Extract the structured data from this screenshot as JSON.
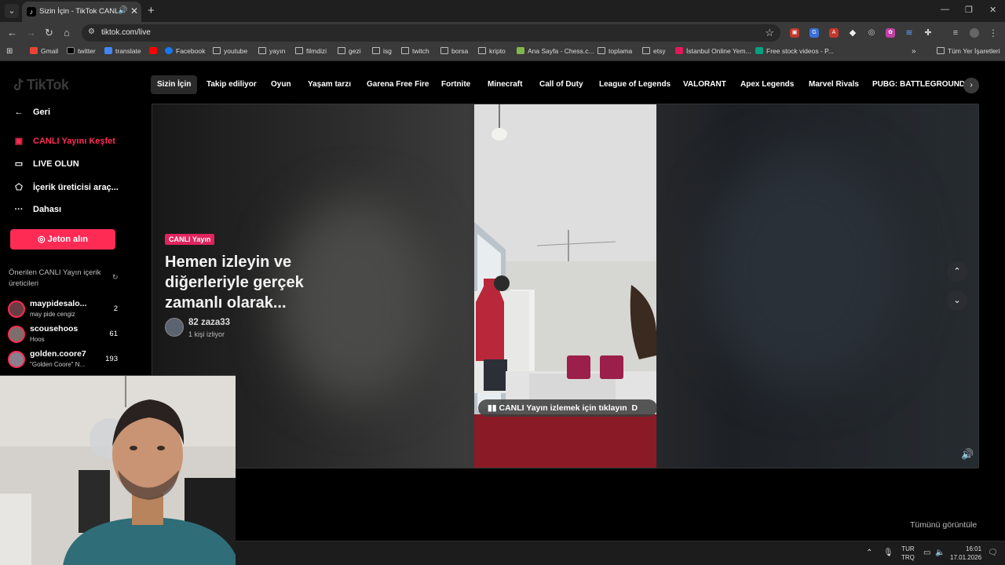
{
  "browser": {
    "tab_title": "Sizin İçin - TikTok CANLI Yayın",
    "url": "tiktok.com/live",
    "bookmarks": [
      "Gmail",
      "twitter",
      "translate",
      "Facebook",
      "youtube",
      "yayın",
      "filmdizi",
      "gezi",
      "isg",
      "twitch",
      "borsa",
      "kripto",
      "Ana Sayfa - Chess.c...",
      "toplama",
      "etsy",
      "İstanbul Online Yem...",
      "Free stock videos - P...",
      "Tüm Yer İşaretleri"
    ]
  },
  "sidebar": {
    "logo": "TikTok",
    "back": "Geri",
    "items": [
      "CANLI Yayını Keşfet",
      "LIVE OLUN",
      "İçerik üreticisi araç...",
      "Dahası"
    ],
    "coin_button": "Jeton alın",
    "suggested_heading": "Önerilen CANLI Yayın içerik üreticileri",
    "creators": [
      {
        "name": "maypidesalo...",
        "sub": "may pide cengiz",
        "count": "2"
      },
      {
        "name": "scousehoos",
        "sub": "Hoos",
        "count": "61"
      },
      {
        "name": "golden.coore7",
        "sub": "\"Golden Coore\" N...",
        "count": "193"
      }
    ]
  },
  "categories": [
    "Sizin İçin",
    "Takip ediliyor",
    "Oyun",
    "Yaşam tarzı",
    "Garena Free Fire",
    "Fortnite",
    "Minecraft",
    "Call of Duty",
    "League of Legends",
    "VALORANT",
    "Apex Legends",
    "Marvel Rivals",
    "PUBG: BATTLEGROUNDS"
  ],
  "player": {
    "badge": "CANLI Yayın",
    "headline": "Hemen izleyin ve diğerleriyle gerçek zamanlı olarak...",
    "host": "82 zaza33",
    "viewers": "1 kişi izliyor",
    "watch_label": "CANLI Yayın izlemek için tıklayın",
    "watch_suffix": "D"
  },
  "see_all": "Tümünü görüntüle",
  "taskbar": {
    "lang_top": "TUR",
    "lang_bottom": "TRQ",
    "time": "16:01",
    "date": "17.01.2026"
  },
  "colors": {
    "accent": "#fe2c55",
    "badge": "#e0245e"
  }
}
